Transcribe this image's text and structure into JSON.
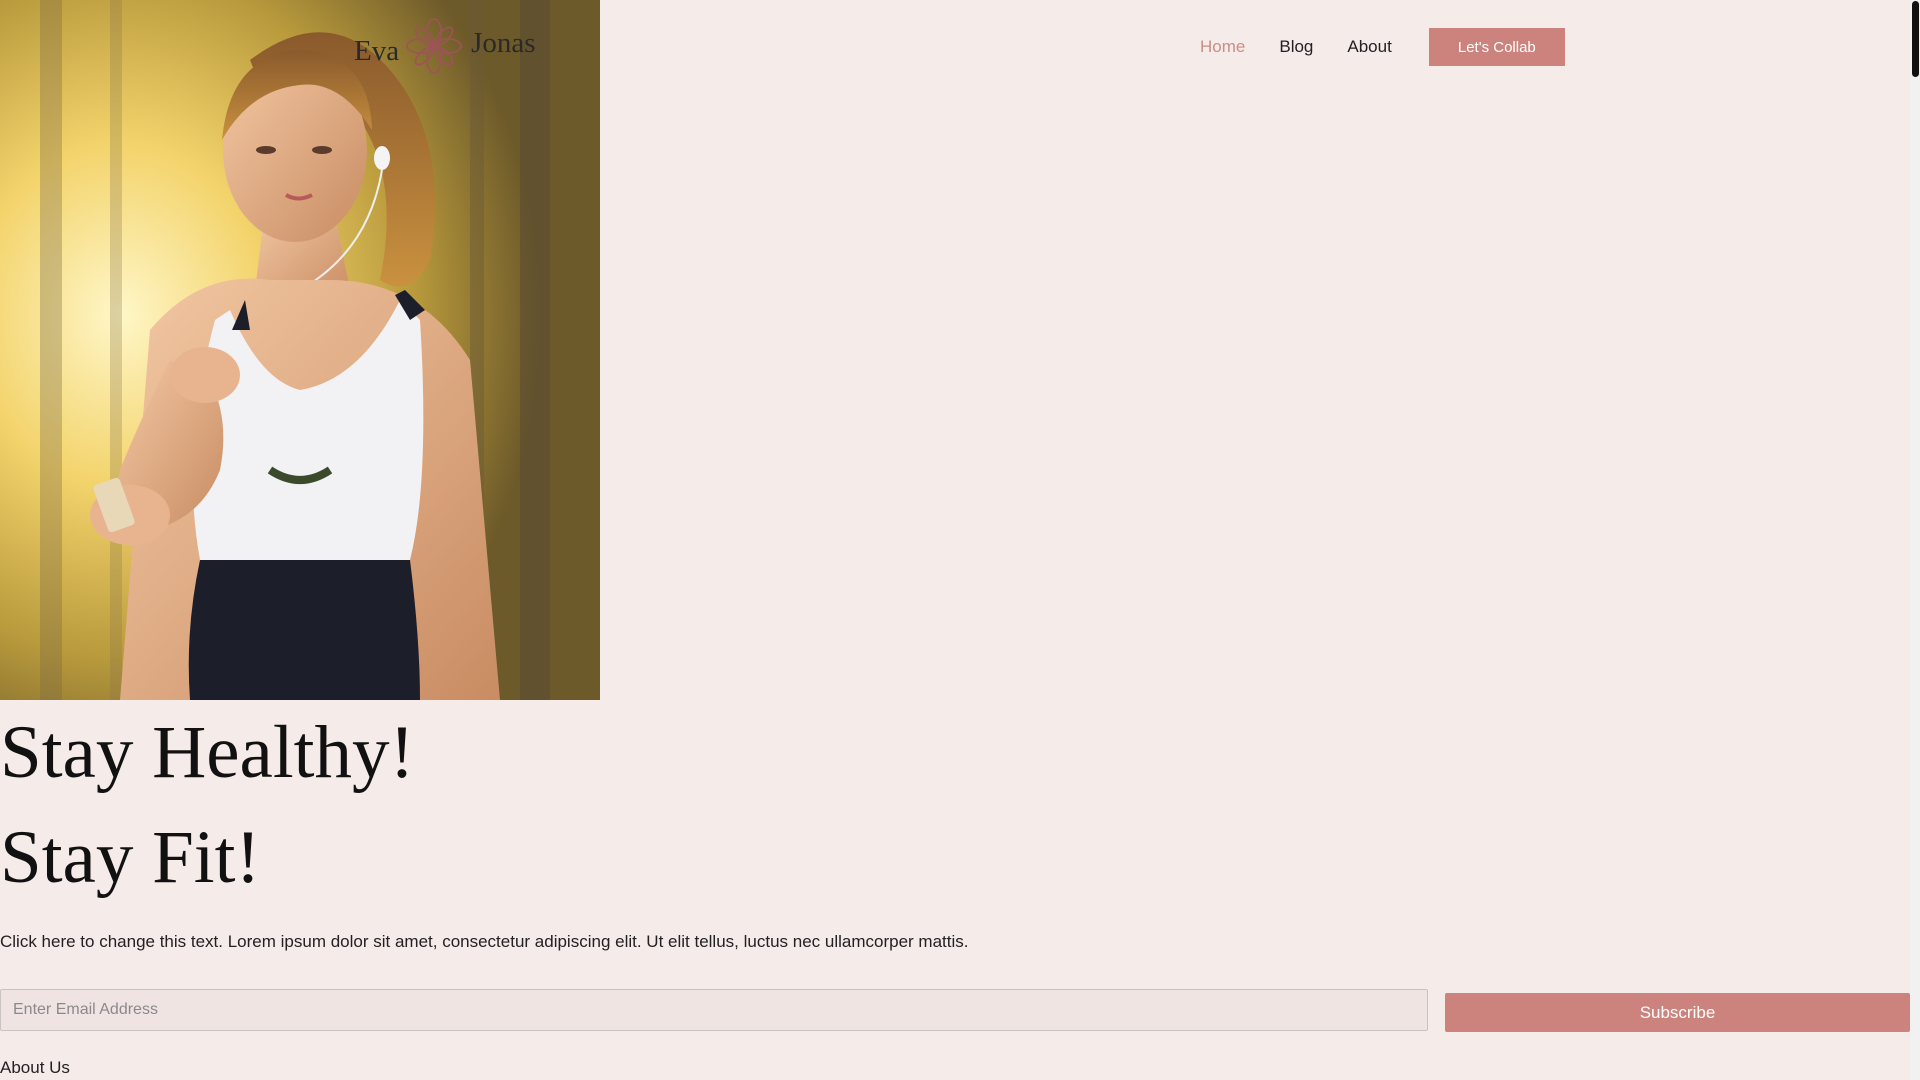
{
  "logo": {
    "first": "Eva",
    "last": "Jonas",
    "icon": "flower-icon",
    "accent": "#a0525a"
  },
  "nav": {
    "items": [
      {
        "label": "Home",
        "active": true
      },
      {
        "label": "Blog",
        "active": false
      },
      {
        "label": "About",
        "active": false
      }
    ],
    "cta_label": "Let's Collab"
  },
  "hero": {
    "image_alt": "woman-jogging-photo",
    "headline_1": "Stay Healthy!",
    "headline_2": "Stay Fit!",
    "body": "Click here to change this text. Lorem ipsum dolor sit amet, consectetur adipiscing elit. Ut elit tellus, luctus nec ullamcorper mattis."
  },
  "subscribe": {
    "placeholder": "Enter Email Address",
    "value": "",
    "button_label": "Subscribe"
  },
  "about": {
    "heading": "About Us"
  },
  "colors": {
    "background": "#f5ebe9",
    "accent": "#cc837d",
    "active_nav": "#c98f87"
  }
}
